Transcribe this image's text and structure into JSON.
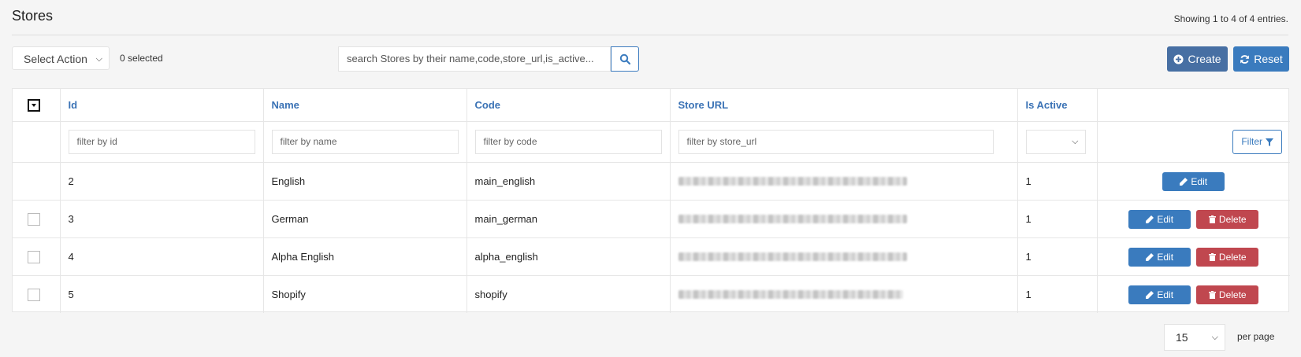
{
  "header": {
    "title": "Stores",
    "showing": "Showing 1 to 4 of 4 entries."
  },
  "toolbar": {
    "select_action": "Select Action",
    "selected_count": "0 selected",
    "search_placeholder": "search Stores by their name,code,store_url,is_active...",
    "create_label": "Create",
    "reset_label": "Reset"
  },
  "table": {
    "columns": [
      "Id",
      "Name",
      "Code",
      "Store URL",
      "Is Active"
    ],
    "filters": {
      "id": "filter by id",
      "name": "filter by name",
      "code": "filter by code",
      "store_url": "filter by store_url",
      "filter_button": "Filter"
    },
    "rows": [
      {
        "id": "2",
        "name": "English",
        "code": "main_english",
        "is_active": "1"
      },
      {
        "id": "3",
        "name": "German",
        "code": "main_german",
        "is_active": "1"
      },
      {
        "id": "4",
        "name": "Alpha English",
        "code": "alpha_english",
        "is_active": "1"
      },
      {
        "id": "5",
        "name": "Shopify",
        "code": "shopify",
        "is_active": "1"
      }
    ],
    "edit_label": "Edit",
    "delete_label": "Delete"
  },
  "pagination": {
    "per_page_value": "15",
    "per_page_label": "per page"
  },
  "colors": {
    "link_blue": "#3a72b5",
    "primary": "#3a7bbe",
    "create_bg": "#476fa3",
    "danger": "#c0474f"
  },
  "icons": {
    "search": "search-icon",
    "create": "plus-circle-icon",
    "reset": "refresh-icon",
    "filter": "funnel-icon",
    "edit": "pencil-icon",
    "delete": "trash-icon"
  }
}
